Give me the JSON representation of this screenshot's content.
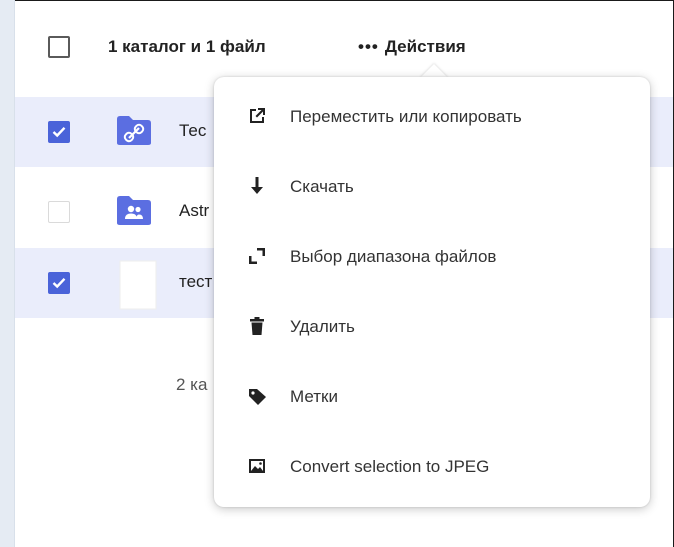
{
  "header": {
    "selection_summary": "1 каталог и 1 файл",
    "actions_label": "Действия",
    "actions_dots": "•••"
  },
  "files": [
    {
      "name": "Тес",
      "icon": "shared-link-folder-icon",
      "checked": true
    },
    {
      "name": "Astr",
      "icon": "group-folder-icon",
      "checked": false
    },
    {
      "name": "тест",
      "icon": "blank-file-icon",
      "checked": true
    }
  ],
  "footer": {
    "count_text": "2 ка"
  },
  "menu": {
    "items": [
      {
        "label": "Переместить или копировать",
        "icon": "open-external-icon"
      },
      {
        "label": "Скачать",
        "icon": "download-arrow-icon"
      },
      {
        "label": "Выбор диапазона файлов",
        "icon": "range-select-icon"
      },
      {
        "label": "Удалить",
        "icon": "trash-icon"
      },
      {
        "label": "Метки",
        "icon": "tag-icon"
      },
      {
        "label": "Convert selection to JPEG",
        "icon": "image-icon"
      }
    ]
  },
  "colors": {
    "accent": "#4a63d9",
    "selected_row": "#eaedfb",
    "folder": "#5b6ee1"
  }
}
